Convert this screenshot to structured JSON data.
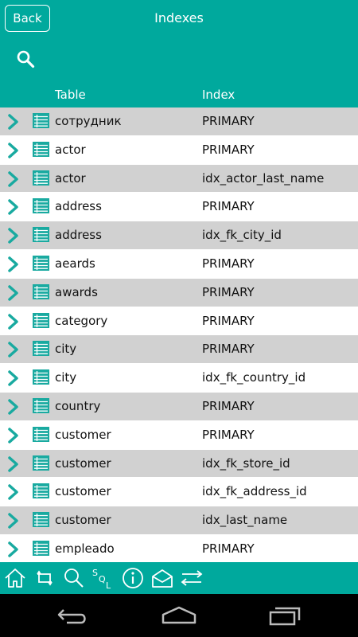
{
  "header": {
    "back_label": "Back",
    "title": "Indexes",
    "search_icon": "search-icon",
    "accent_color": "#00a99d"
  },
  "columns": {
    "table": "Table",
    "index": "Index"
  },
  "rows": [
    {
      "table": "сотрудник",
      "index": "PRIMARY"
    },
    {
      "table": "actor",
      "index": "PRIMARY"
    },
    {
      "table": "actor",
      "index": "idx_actor_last_name"
    },
    {
      "table": "address",
      "index": "PRIMARY"
    },
    {
      "table": "address",
      "index": "idx_fk_city_id"
    },
    {
      "table": "aeards",
      "index": "PRIMARY"
    },
    {
      "table": "awards",
      "index": "PRIMARY"
    },
    {
      "table": "category",
      "index": "PRIMARY"
    },
    {
      "table": "city",
      "index": "PRIMARY"
    },
    {
      "table": "city",
      "index": "idx_fk_country_id"
    },
    {
      "table": "country",
      "index": "PRIMARY"
    },
    {
      "table": "customer",
      "index": "PRIMARY"
    },
    {
      "table": "customer",
      "index": "idx_fk_store_id"
    },
    {
      "table": "customer",
      "index": "idx_fk_address_id"
    },
    {
      "table": "customer",
      "index": "idx_last_name"
    },
    {
      "table": "empleado",
      "index": "PRIMARY"
    }
  ],
  "toolbar": {
    "icons": [
      "home-icon",
      "refresh-icon",
      "search-icon",
      "sql-icon",
      "info-icon",
      "mail-icon",
      "transfer-icon"
    ],
    "sql_letters": [
      "S",
      "Q",
      "L"
    ]
  },
  "system_nav": {
    "icons": [
      "back-icon",
      "home-icon",
      "recent-apps-icon"
    ]
  }
}
